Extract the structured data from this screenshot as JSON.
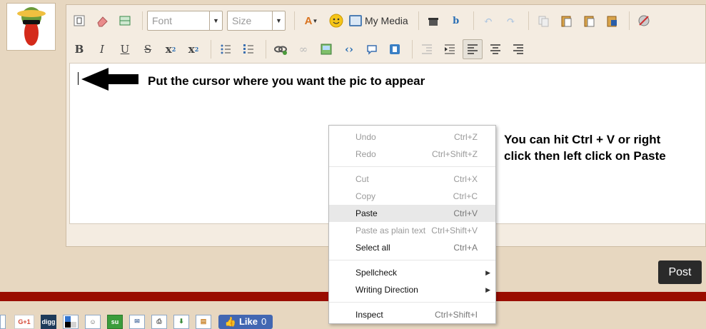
{
  "toolbar": {
    "font_placeholder": "Font",
    "size_placeholder": "Size",
    "my_media_label": "My Media",
    "bold_glyph": "B",
    "italic_glyph": "I",
    "underline_glyph": "U",
    "strike_glyph": "S"
  },
  "editor": {
    "note_cursor": "Put the cursor where you want the pic to appear",
    "note_paste_line1": "You can hit Ctrl + V or right",
    "note_paste_line2": "click then left click on Paste"
  },
  "context_menu": {
    "items": [
      {
        "label": "Undo",
        "shortcut": "Ctrl+Z"
      },
      {
        "label": "Redo",
        "shortcut": "Ctrl+Shift+Z"
      },
      {
        "label": "Cut",
        "shortcut": "Ctrl+X"
      },
      {
        "label": "Copy",
        "shortcut": "Ctrl+C"
      },
      {
        "label": "Paste",
        "shortcut": "Ctrl+V"
      },
      {
        "label": "Paste as plain text",
        "shortcut": "Ctrl+Shift+V"
      },
      {
        "label": "Select all",
        "shortcut": "Ctrl+A"
      },
      {
        "label": "Spellcheck",
        "shortcut": ""
      },
      {
        "label": "Writing Direction",
        "shortcut": ""
      },
      {
        "label": "Inspect",
        "shortcut": "Ctrl+Shift+I"
      }
    ]
  },
  "post_button": "Post",
  "share": {
    "gplus": "G+1",
    "digg": "digg",
    "stumble": "su",
    "like_label": "Like",
    "like_count": "0"
  },
  "colors": {
    "page_bg": "#e7d7c0",
    "red_band": "#9a0d00",
    "post_bg": "#2a2a2a",
    "fb_blue": "#4267b2"
  }
}
